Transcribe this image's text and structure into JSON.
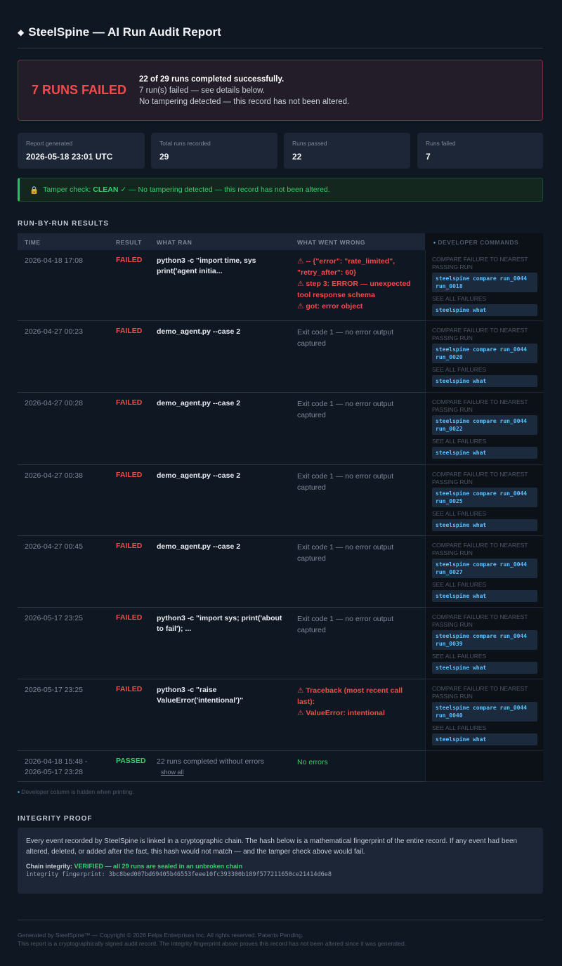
{
  "header": {
    "icon": "diamond-icon",
    "title": "SteelSpine — AI Run Audit Report"
  },
  "banner": {
    "big": "7 RUNS FAILED",
    "line1": "22 of 29 runs completed successfully.",
    "line2": "7 run(s) failed — see details below.",
    "line3": "No tampering detected — this record has not been altered."
  },
  "stats": [
    {
      "label": "Report generated",
      "value": "2026-05-18 23:01 UTC"
    },
    {
      "label": "Total runs recorded",
      "value": "29"
    },
    {
      "label": "Runs passed",
      "value": "22"
    },
    {
      "label": "Runs failed",
      "value": "7"
    }
  ],
  "tamper": {
    "prefix": "Tamper check:",
    "status": "CLEAN ✓",
    "message": "— No tampering detected — this record has not been altered."
  },
  "section_results": "RUN-BY-RUN RESULTS",
  "table": {
    "headers": {
      "time": "TIME",
      "result": "RESULT",
      "ran": "WHAT RAN",
      "wrong": "WHAT WENT WRONG"
    },
    "dev_header": "DEVELOPER COMMANDS",
    "rows": [
      {
        "time": "2026-04-18 17:08",
        "time2": "",
        "result": "FAILED",
        "ran": "python3 -c \"import time, sys print('agent initia...",
        "wrong": [
          "⚠ -- {\"error\": \"rate_limited\", \"retry_after\": 60}",
          "⚠ step 3: ERROR — unexpected tool response schema",
          "⚠ got: error object"
        ],
        "wrong_kind": "err",
        "compare_cmd": "steelspine compare run_0044 run_0018"
      },
      {
        "time": "2026-04-27 00:23",
        "time2": "",
        "result": "FAILED",
        "ran": "demo_agent.py --case 2",
        "wrong": [
          "Exit code 1 — no error output captured"
        ],
        "wrong_kind": "muted",
        "compare_cmd": "steelspine compare run_0044 run_0020"
      },
      {
        "time": "2026-04-27 00:28",
        "time2": "",
        "result": "FAILED",
        "ran": "demo_agent.py --case 2",
        "wrong": [
          "Exit code 1 — no error output captured"
        ],
        "wrong_kind": "muted",
        "compare_cmd": "steelspine compare run_0044 run_0022"
      },
      {
        "time": "2026-04-27 00:38",
        "time2": "",
        "result": "FAILED",
        "ran": "demo_agent.py --case 2",
        "wrong": [
          "Exit code 1 — no error output captured"
        ],
        "wrong_kind": "muted",
        "compare_cmd": "steelspine compare run_0044 run_0025"
      },
      {
        "time": "2026-04-27 00:45",
        "time2": "",
        "result": "FAILED",
        "ran": "demo_agent.py --case 2",
        "wrong": [
          "Exit code 1 — no error output captured"
        ],
        "wrong_kind": "muted",
        "compare_cmd": "steelspine compare run_0044 run_0027"
      },
      {
        "time": "2026-05-17 23:25",
        "time2": "",
        "result": "FAILED",
        "ran": "python3 -c \"import sys; print('about to fail'); ...",
        "wrong": [
          "Exit code 1 — no error output captured"
        ],
        "wrong_kind": "muted",
        "compare_cmd": "steelspine compare run_0044 run_0039"
      },
      {
        "time": "2026-05-17 23:25",
        "time2": "",
        "result": "FAILED",
        "ran": "python3 -c \"raise ValueError('intentional')\"",
        "wrong": [
          "⚠ Traceback (most recent call last):",
          "⚠ ValueError: intentional"
        ],
        "wrong_kind": "err",
        "compare_cmd": "steelspine compare run_0044 run_0040"
      },
      {
        "time": "2026-04-18 15:48 -",
        "time2": "2026-05-17 23:28",
        "result": "PASSED",
        "ran": "22 runs completed without errors",
        "show_all": "show all",
        "wrong": [
          "No errors"
        ],
        "wrong_kind": "ok"
      }
    ],
    "dev_compare_label": "COMPARE FAILURE TO NEAREST PASSING RUN",
    "dev_see_all_label": "SEE ALL FAILURES",
    "dev_see_all_cmd": "steelspine what"
  },
  "dev_note": "Developer column is hidden when printing.",
  "section_integrity": "INTEGRITY PROOF",
  "integrity": {
    "para": "Every event recorded by SteelSpine is linked in a cryptographic chain. The hash below is a mathematical fingerprint of the entire record. If any event had been altered, deleted, or added after the fact, this hash would not match — and the tamper check above would fail.",
    "chain_label": "Chain integrity:",
    "chain_status": "VERIFIED — all 29 runs are sealed in an unbroken chain",
    "fingerprint": "integrity fingerprint: 3bc8bed007bd69405b46553feee10fc393300b189f577211650ce21414d6e8"
  },
  "footer": {
    "line1": "Generated by SteelSpine™ — Copyright © 2026 Felps Enterprises Inc. All rights reserved. Patents Pending.",
    "line2": "This report is a cryptographically signed audit record. The integrity fingerprint above proves this record has not been altered since it was generated."
  },
  "colors": {
    "fail": "#f14b4b",
    "pass": "#35d06d",
    "accent": "#5bc0ff",
    "background": "#0f1723"
  }
}
